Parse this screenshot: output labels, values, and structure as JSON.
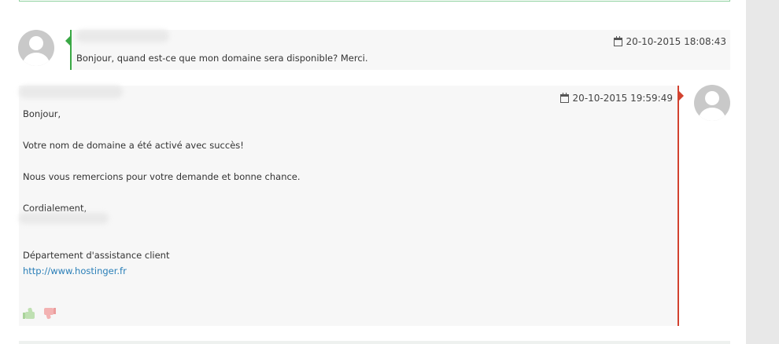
{
  "client_message": {
    "author": "",
    "date": "20-10-2015 18:08:43",
    "text": "Bonjour, quand est-ce que mon domaine sera disponible? Merci.",
    "accent_color": "#3aa845"
  },
  "staff_message": {
    "author": "",
    "date": "20-10-2015 19:59:49",
    "lines": {
      "l0": "Bonjour,",
      "l1": "",
      "l2": "Votre nom de domaine a été activé avec succès!",
      "l3": "",
      "l4": "Nous vous remercions pour votre demande et bonne chance.",
      "l5": "",
      "l6": "Cordialement,",
      "l7": "",
      "l8": "",
      "l9": "Département d'assistance client",
      "link": "http://www.hostinger.fr"
    },
    "accent_color": "#d2422f"
  },
  "icons": {
    "avatar": "user-avatar-icon",
    "date": "calendar-icon",
    "like": "thumbs-up-icon",
    "dislike": "thumbs-down-icon"
  }
}
